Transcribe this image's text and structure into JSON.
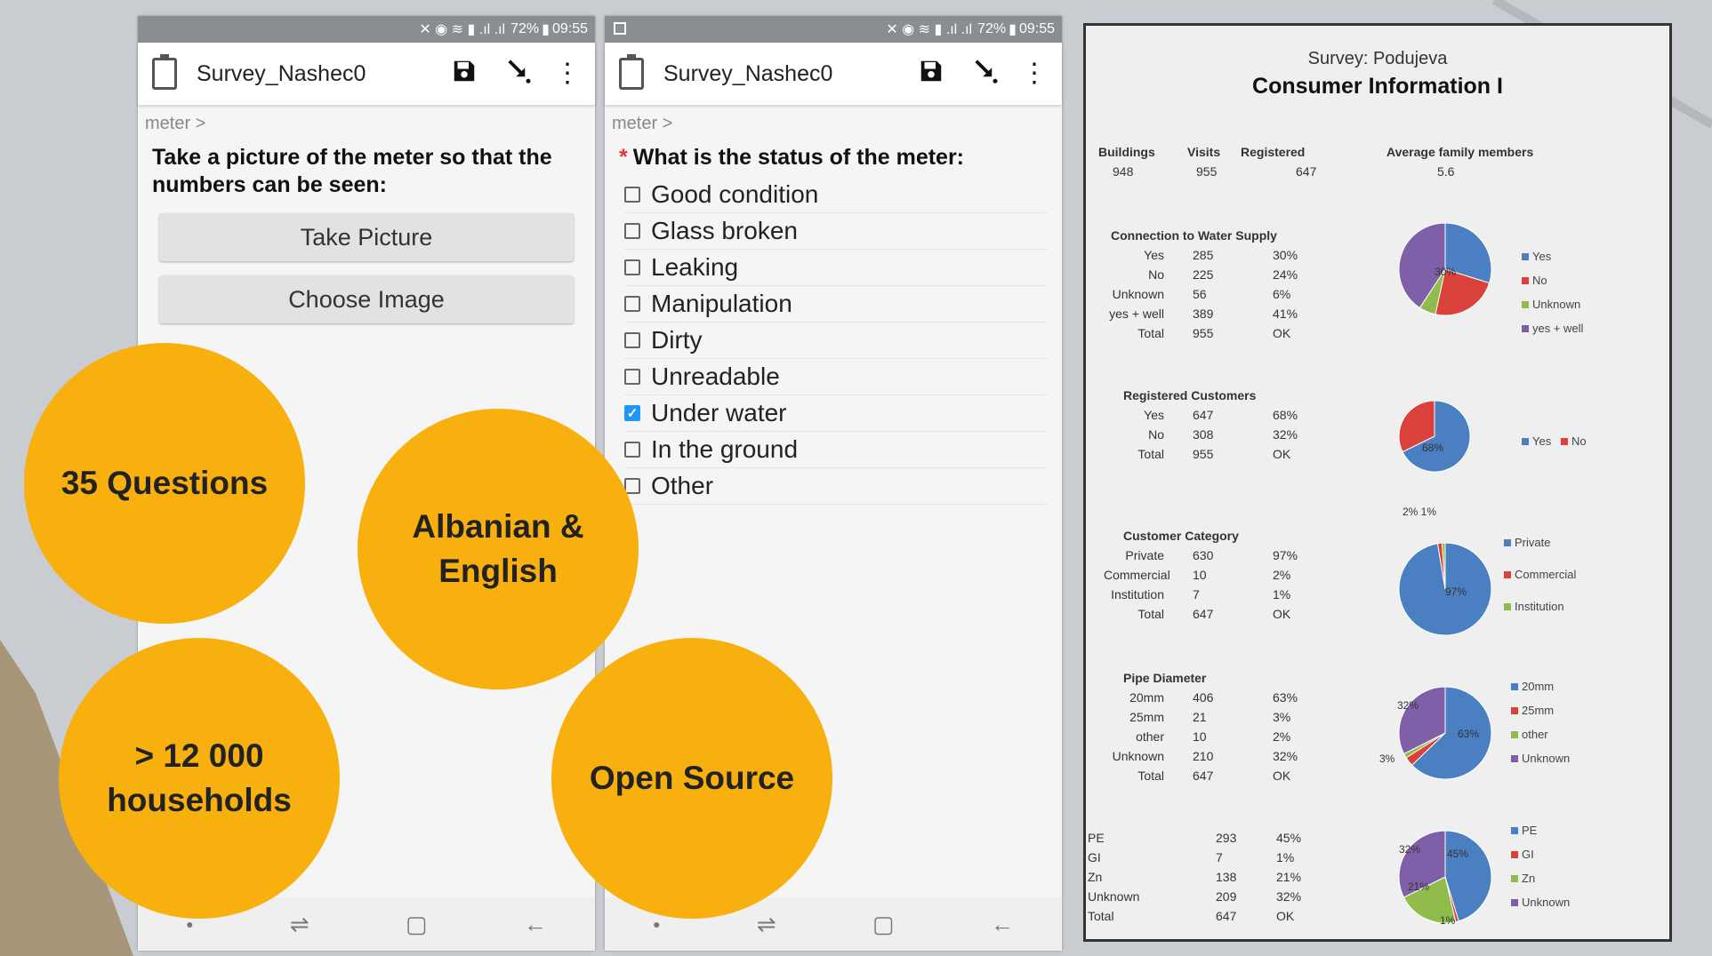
{
  "status_bar": {
    "battery": "72%",
    "time": "09:55"
  },
  "phone1": {
    "app_title": "Survey_Nashec0",
    "breadcrumb": "meter >",
    "question": "Take a picture of the meter so that the numbers can be seen:",
    "take_picture": "Take Picture",
    "choose_image": "Choose Image"
  },
  "phone2": {
    "app_title": "Survey_Nashec0",
    "breadcrumb": "meter >",
    "required_mark": "*",
    "question": "What is the status of the meter:",
    "options": [
      {
        "label": "Good condition",
        "checked": false
      },
      {
        "label": "Glass broken",
        "checked": false
      },
      {
        "label": "Leaking",
        "checked": false
      },
      {
        "label": "Manipulation",
        "checked": false
      },
      {
        "label": "Dirty",
        "checked": false
      },
      {
        "label": "Unreadable",
        "checked": false
      },
      {
        "label": "Under water",
        "checked": true
      },
      {
        "label": "In the ground",
        "checked": false
      },
      {
        "label": "Other",
        "checked": false
      }
    ]
  },
  "highlights": {
    "questions": "35 Questions",
    "language_1": "Albanian &",
    "language_2": "English",
    "households_1": "> 12 000",
    "households_2": "households",
    "open_source": "Open Source"
  },
  "report": {
    "subtitle": "Survey: Podujeva",
    "title": "Consumer Information I",
    "summary": {
      "buildings_label": "Buildings",
      "buildings": "948",
      "visits_label": "Visits",
      "visits": "955",
      "registered_label": "Registered",
      "registered": "647",
      "family_label": "Average family members",
      "family": "5.6"
    },
    "sections": [
      {
        "title": "Connection to Water Supply",
        "rows": [
          [
            "Yes",
            "285",
            "30%"
          ],
          [
            "No",
            "225",
            "24%"
          ],
          [
            "Unknown",
            "56",
            "6%"
          ],
          [
            "yes + well",
            "389",
            "41%"
          ],
          [
            "Total",
            "955",
            "OK"
          ]
        ],
        "pie_labels": [
          "30%"
        ]
      },
      {
        "title": "Registered Customers",
        "rows": [
          [
            "Yes",
            "647",
            "68%"
          ],
          [
            "No",
            "308",
            "32%"
          ],
          [
            "Total",
            "955",
            "OK"
          ]
        ],
        "pie_labels": [
          "68%"
        ]
      },
      {
        "title": "Customer Category",
        "rows": [
          [
            "Private",
            "630",
            "97%"
          ],
          [
            "Commercial",
            "10",
            "2%"
          ],
          [
            "Institution",
            "7",
            "1%"
          ],
          [
            "Total",
            "647",
            "OK"
          ]
        ],
        "pie_labels": [
          "2% 1%",
          "97%"
        ]
      },
      {
        "title": "Pipe Diameter",
        "rows": [
          [
            "20mm",
            "406",
            "63%"
          ],
          [
            "25mm",
            "21",
            "3%"
          ],
          [
            "other",
            "10",
            "2%"
          ],
          [
            "Unknown",
            "210",
            "32%"
          ],
          [
            "Total",
            "647",
            "OK"
          ]
        ],
        "pie_labels": [
          "32%",
          "63%",
          "3%"
        ]
      },
      {
        "title": "",
        "rows": [
          [
            "PE",
            "293",
            "45%"
          ],
          [
            "GI",
            "7",
            "1%"
          ],
          [
            "Zn",
            "138",
            "21%"
          ],
          [
            "Unknown",
            "209",
            "32%"
          ],
          [
            "Total",
            "647",
            "OK"
          ]
        ],
        "pie_labels": [
          "32%",
          "45%",
          "21%",
          "1%"
        ]
      }
    ]
  },
  "chart_data": [
    {
      "type": "pie",
      "categories": [
        "Yes",
        "No",
        "Unknown",
        "yes + well"
      ],
      "values": [
        285,
        225,
        56,
        389
      ],
      "colors": [
        "#4a7fc1",
        "#d9413a",
        "#8fbc4b",
        "#7f5fa8"
      ]
    },
    {
      "type": "pie",
      "categories": [
        "Yes",
        "No"
      ],
      "values": [
        647,
        308
      ],
      "colors": [
        "#4a7fc1",
        "#d9413a"
      ]
    },
    {
      "type": "pie",
      "categories": [
        "Private",
        "Commercial",
        "Institution"
      ],
      "values": [
        630,
        10,
        7
      ],
      "colors": [
        "#4a7fc1",
        "#d9413a",
        "#8fbc4b"
      ]
    },
    {
      "type": "pie",
      "categories": [
        "20mm",
        "25mm",
        "other",
        "Unknown"
      ],
      "values": [
        406,
        21,
        10,
        210
      ],
      "colors": [
        "#4a7fc1",
        "#d9413a",
        "#8fbc4b",
        "#7f5fa8"
      ]
    },
    {
      "type": "pie",
      "categories": [
        "PE",
        "GI",
        "Zn",
        "Unknown"
      ],
      "values": [
        293,
        7,
        138,
        209
      ],
      "colors": [
        "#4a7fc1",
        "#d9413a",
        "#8fbc4b",
        "#7f5fa8"
      ]
    }
  ],
  "colors": {
    "accent_circle": "#f8b00f",
    "checkbox_checked": "#2196f3",
    "status_bar": "#8a8d91"
  }
}
